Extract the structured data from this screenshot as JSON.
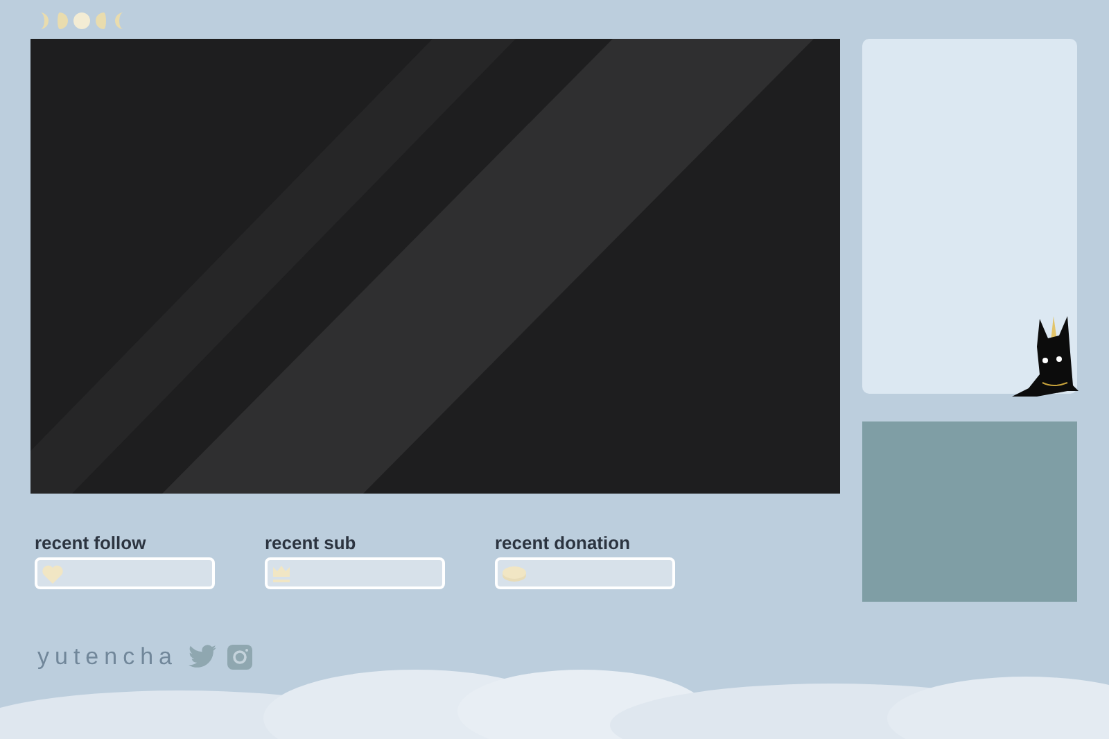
{
  "widgets": [
    {
      "label": "recent follow",
      "kind": "heart"
    },
    {
      "label": "recent sub",
      "kind": "crown"
    },
    {
      "label": "recent donation",
      "kind": "coin"
    }
  ],
  "brand": {
    "name": "yutencha"
  }
}
